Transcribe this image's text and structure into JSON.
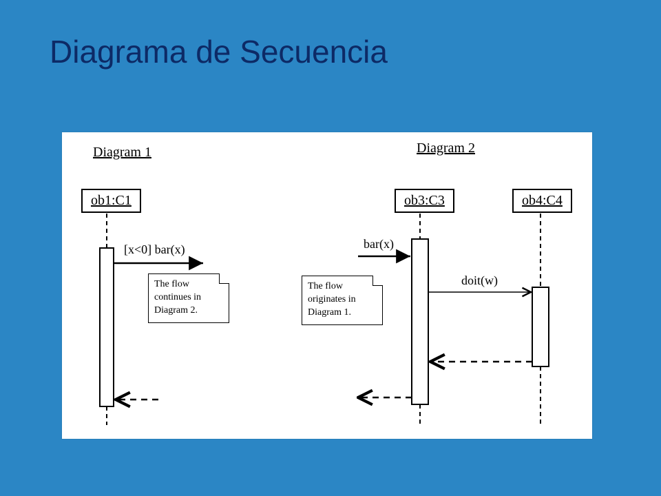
{
  "title": "Diagrama de Secuencia",
  "diagram1": {
    "label": "Diagram 1",
    "object": "ob1:C1",
    "message": "[x<0] bar(x)",
    "note_l1": "The flow",
    "note_l2": "continues in",
    "note_l3": "Diagram 2."
  },
  "diagram2": {
    "label": "Diagram 2",
    "object_left": "ob3:C3",
    "object_right": "ob4:C4",
    "incoming_msg": "bar(x)",
    "call_msg": "doit(w)",
    "note_l1": "The flow",
    "note_l2": "originates in",
    "note_l3": "Diagram 1."
  }
}
